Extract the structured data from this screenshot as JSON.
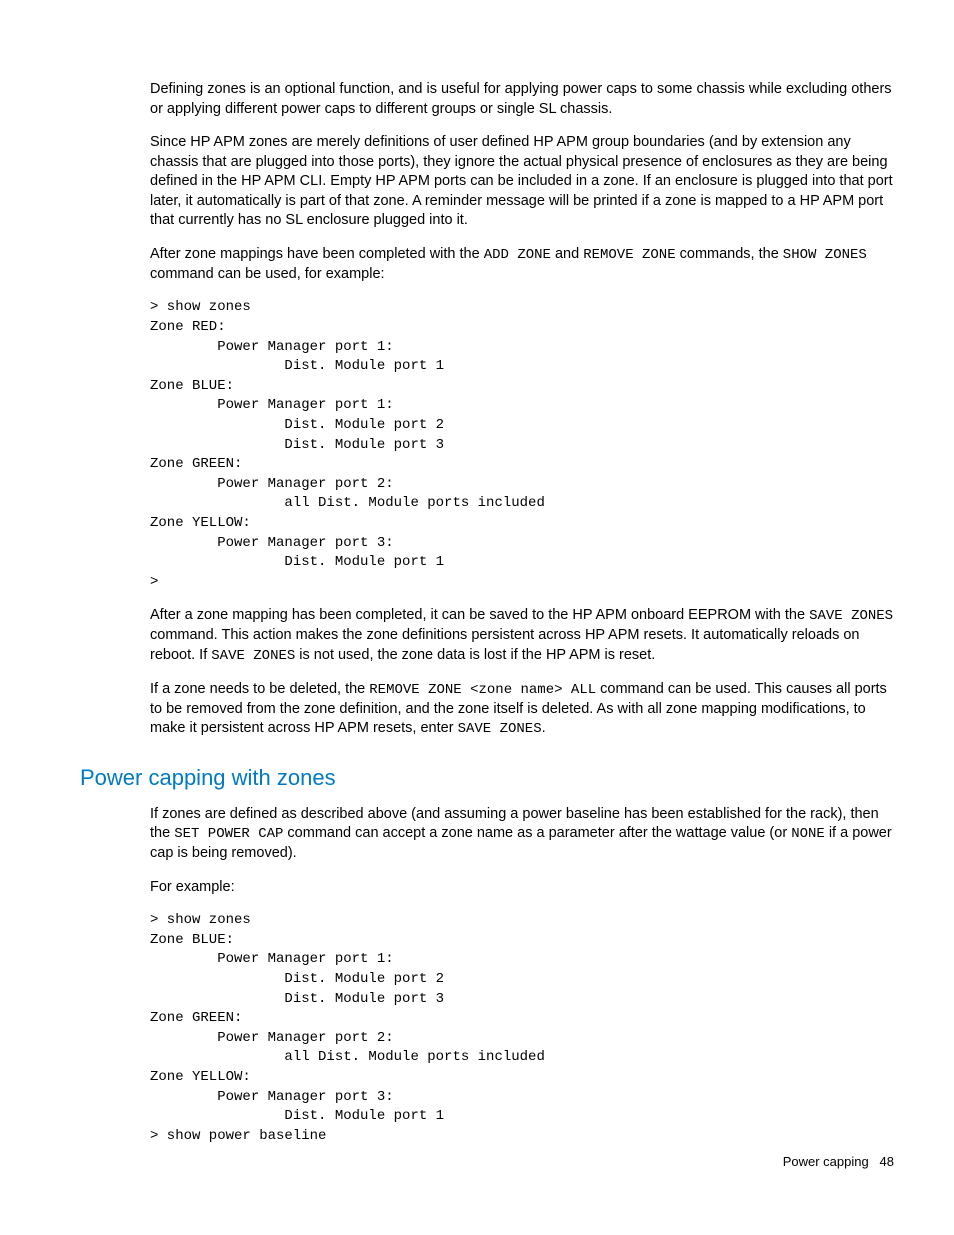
{
  "para1": "Defining zones is an optional function, and is useful for applying power caps to some chassis while excluding others or applying different power caps to different groups or single SL chassis.",
  "para2": "Since HP APM zones are merely definitions of user defined HP APM group boundaries (and by extension any chassis that are plugged into those ports), they ignore the actual physical presence of enclosures as they are being defined in the HP APM CLI. Empty HP APM ports can be included in a zone. If an enclosure is plugged into that port later, it automatically is part of that zone. A reminder message will be printed if a zone is mapped to a HP APM port that currently has no SL enclosure plugged into it.",
  "para3a": "After zone mappings have been completed with the ",
  "cmd_add": "ADD ZONE",
  "para3b": " and ",
  "cmd_remove": "REMOVE ZONE",
  "para3c": " commands, the ",
  "cmd_show": "SHOW ZONES",
  "para3d": " command can be used, for example:",
  "code1": "> show zones\nZone RED:\n        Power Manager port 1:\n                Dist. Module port 1\nZone BLUE:\n        Power Manager port 1:\n                Dist. Module port 2\n                Dist. Module port 3\nZone GREEN:\n        Power Manager port 2:\n                all Dist. Module ports included\nZone YELLOW:\n        Power Manager port 3:\n                Dist. Module port 1\n>",
  "para4a": "After a zone mapping has been completed, it can be saved to the HP APM onboard EEPROM with the ",
  "cmd_save": "SAVE ZONES",
  "para4b": " command. This action makes the zone definitions persistent across HP APM resets. It automatically reloads on reboot. If ",
  "para4c": " is not used, the zone data is lost if the HP APM is reset.",
  "para5a": "If a zone needs to be deleted, the ",
  "cmd_removeall": "REMOVE ZONE <zone name> ALL",
  "para5b": " command can be used. This causes all ports to be removed from the zone definition, and the zone itself is deleted. As with all zone mapping modifications, to make it persistent across HP APM resets, enter ",
  "para5c": ".",
  "section_heading": "Power capping with zones",
  "para6a": "If zones are defined as described above (and assuming a power baseline has been established for the rack), then the ",
  "cmd_setpower": "SET POWER CAP",
  "para6b": " command can accept a zone name as a parameter after the wattage value (or ",
  "cmd_none": "NONE",
  "para6c": " if a power cap is being removed).",
  "para7": "For example:",
  "code2": "> show zones\nZone BLUE:\n        Power Manager port 1:\n                Dist. Module port 2\n                Dist. Module port 3\nZone GREEN:\n        Power Manager port 2:\n                all Dist. Module ports included\nZone YELLOW:\n        Power Manager port 3:\n                Dist. Module port 1\n> show power baseline",
  "footer_label": "Power capping",
  "footer_page": "48"
}
